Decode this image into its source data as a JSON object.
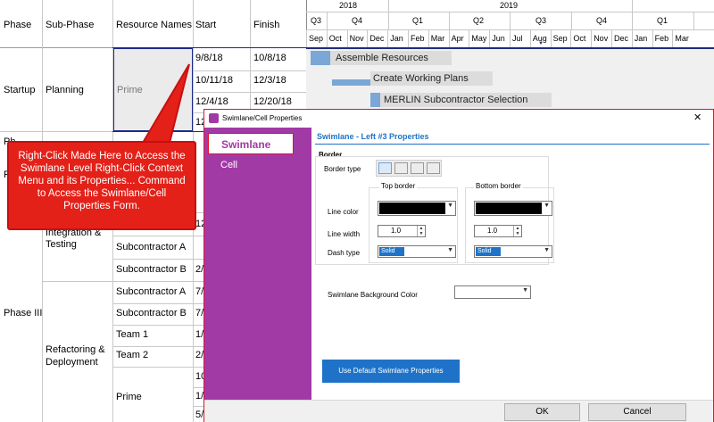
{
  "table": {
    "headers": {
      "phase": "Phase",
      "sub_phase": "Sub-Phase",
      "resource": "Resource Names",
      "start": "Start",
      "finish": "Finish"
    },
    "phases": {
      "startup": "Startup",
      "phase3": "Phase III",
      "partial1": "Ph",
      "partial2": "P"
    },
    "subphases": {
      "planning": "Planning",
      "integration": "Integration &",
      "testing": "Testing",
      "refactoring": "Refactoring &",
      "deployment": "Deployment"
    },
    "resources": {
      "prime_top": "Prime",
      "sub_a1": "Subcontractor A",
      "sub_b1": "Subcontractor B",
      "sub_a2": "Subcontractor A",
      "sub_b2": "Subcontractor B",
      "team1": "Team 1",
      "team2": "Team 2",
      "prime_bottom": "Prime"
    },
    "rows": [
      {
        "start": "9/8/18",
        "finish": "10/8/18"
      },
      {
        "start": "10/11/18",
        "finish": "12/3/18"
      },
      {
        "start": "12/4/18",
        "finish": "12/20/18"
      },
      {
        "start": "12",
        "finish": ""
      }
    ],
    "partial_starts": [
      "12",
      "2/",
      "7/",
      "7/",
      "1/",
      "2/",
      "10",
      "1/",
      "5/"
    ]
  },
  "timeline": {
    "years": [
      "2018",
      "2019"
    ],
    "quarters": [
      "Q3",
      "Q4",
      "Q1",
      "Q2",
      "Q3",
      "Q4",
      "Q1"
    ],
    "months": [
      "Sep",
      "Oct",
      "Nov",
      "Dec",
      "Jan",
      "Feb",
      "Mar",
      "Apr",
      "May",
      "Jun",
      "Jul",
      "Aug",
      "Sep",
      "Oct",
      "Nov",
      "Dec",
      "Jan",
      "Feb",
      "Mar"
    ]
  },
  "tasks": [
    "Assemble Resources",
    "Create Working Plans",
    "MERLIN Subcontractor Selection"
  ],
  "callout": "Right-Click Made Here to Access the Swimlane Level Right-Click Context Menu and its Properties... Command to Access the Swimlane/Cell Properties Form.",
  "dialog": {
    "title": "Swimlane/Cell Properties",
    "close": "✕",
    "nav": [
      "Swimlane",
      "Cell"
    ],
    "heading": "Swimlane - Left #3 Properties",
    "border_section": "Border",
    "border_type": "Border type",
    "top_border": "Top border",
    "bottom_border": "Bottom border",
    "line_color": "Line color",
    "line_width": "Line width",
    "dash_type": "Dash type",
    "top_width": "1.0",
    "bottom_width": "1.0",
    "top_dash": "Solid",
    "bottom_dash": "Solid",
    "bg_color_label": "Swimlane Background Color",
    "default_button": "Use Default Swimlane Properties",
    "ok": "OK",
    "cancel": "Cancel"
  }
}
